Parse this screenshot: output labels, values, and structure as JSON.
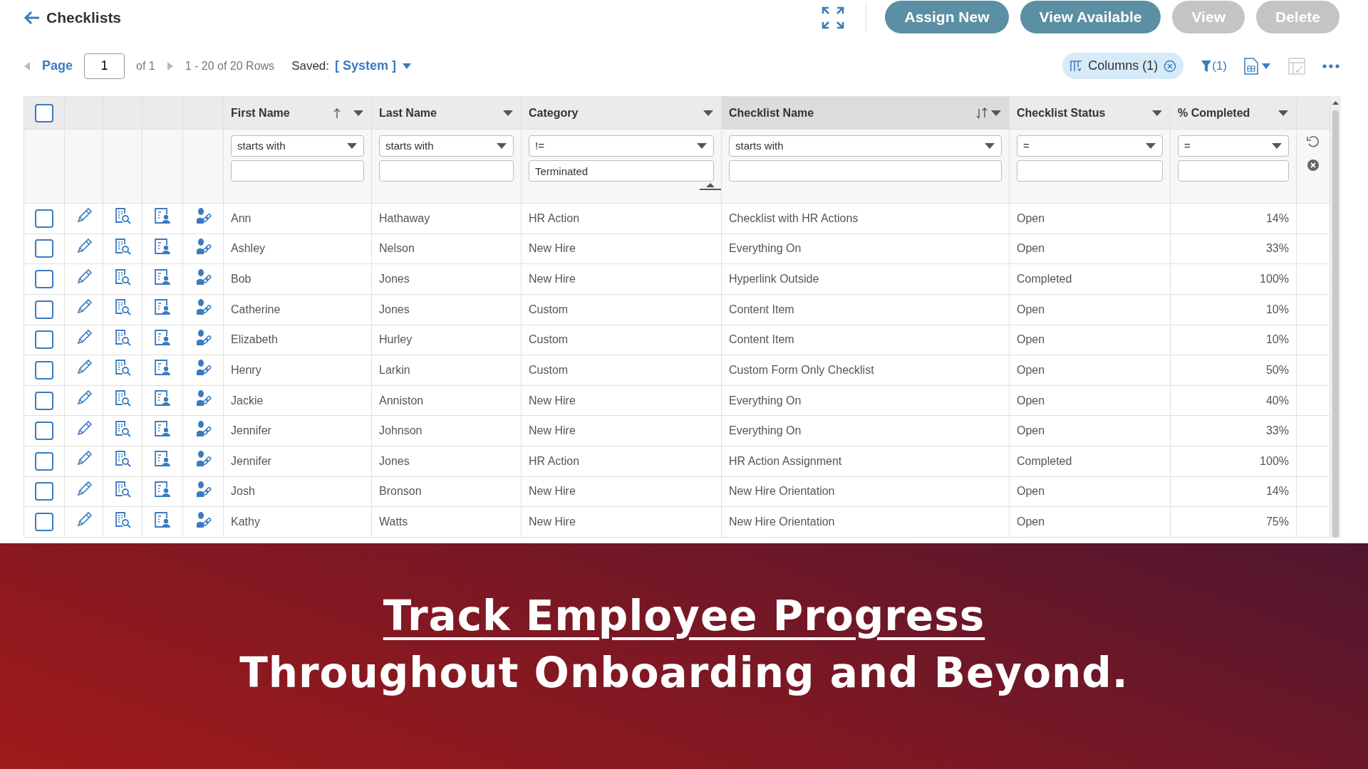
{
  "header": {
    "title": "Checklists"
  },
  "actions": [
    {
      "label": "Assign New",
      "disabled": false
    },
    {
      "label": "View Available",
      "disabled": false
    },
    {
      "label": "View",
      "disabled": true
    },
    {
      "label": "Delete",
      "disabled": true
    }
  ],
  "pager": {
    "page_label": "Page",
    "page": "1",
    "of": "of 1",
    "rows": "1 - 20 of 20 Rows",
    "saved_label": "Saved:",
    "saved_value": "[ System ]"
  },
  "tools": {
    "columns_chip": "Columns (1)",
    "filter_count": "(1)"
  },
  "table": {
    "all_checked": false,
    "columns": [
      {
        "label": "First Name",
        "sorted_ascending": true,
        "sort_toggle": false,
        "highlighted": false,
        "operator": "starts with"
      },
      {
        "label": "Last Name",
        "sorted_ascending": false,
        "sort_toggle": false,
        "highlighted": false,
        "operator": "starts with"
      },
      {
        "label": "Category",
        "sorted_ascending": false,
        "sort_toggle": false,
        "highlighted": false,
        "operator": "!=",
        "value": "Terminated"
      },
      {
        "label": "Checklist Name",
        "sorted_ascending": false,
        "sort_toggle": true,
        "highlighted": true,
        "operator": "starts with"
      },
      {
        "label": "Checklist Status",
        "sorted_ascending": false,
        "sort_toggle": false,
        "highlighted": false,
        "operator": "="
      },
      {
        "label": "% Completed",
        "sorted_ascending": false,
        "sort_toggle": false,
        "highlighted": false,
        "operator": "="
      }
    ],
    "rows": [
      {
        "checked": false,
        "cells": [
          "Ann",
          "Hathaway",
          "HR Action",
          "Checklist with HR Actions",
          "Open",
          "14%"
        ]
      },
      {
        "checked": false,
        "cells": [
          "Ashley",
          "Nelson",
          "New Hire",
          "Everything On",
          "Open",
          "33%"
        ]
      },
      {
        "checked": false,
        "cells": [
          "Bob",
          "Jones",
          "New Hire",
          "Hyperlink Outside",
          "Completed",
          "100%"
        ]
      },
      {
        "checked": false,
        "cells": [
          "Catherine",
          "Jones",
          "Custom",
          "Content Item",
          "Open",
          "10%"
        ]
      },
      {
        "checked": false,
        "cells": [
          "Elizabeth",
          "Hurley",
          "Custom",
          "Content Item",
          "Open",
          "10%"
        ]
      },
      {
        "checked": false,
        "cells": [
          "Henry",
          "Larkin",
          "Custom",
          "Custom Form Only Checklist",
          "Open",
          "50%"
        ]
      },
      {
        "checked": false,
        "cells": [
          "Jackie",
          "Anniston",
          "New Hire",
          "Everything On",
          "Open",
          "40%"
        ]
      },
      {
        "checked": false,
        "cells": [
          "Jennifer",
          "Johnson",
          "New Hire",
          "Everything On",
          "Open",
          "33%"
        ]
      },
      {
        "checked": false,
        "cells": [
          "Jennifer",
          "Jones",
          "HR Action",
          "HR Action Assignment",
          "Completed",
          "100%"
        ]
      },
      {
        "checked": false,
        "cells": [
          "Josh",
          "Bronson",
          "New Hire",
          "New Hire Orientation",
          "Open",
          "14%"
        ]
      },
      {
        "checked": false,
        "cells": [
          "Kathy",
          "Watts",
          "New Hire",
          "New Hire Orientation",
          "Open",
          "75%"
        ]
      }
    ]
  },
  "banner": {
    "headline": "Track Employee Progress",
    "subline": "Throughout Onboarding and Beyond."
  }
}
